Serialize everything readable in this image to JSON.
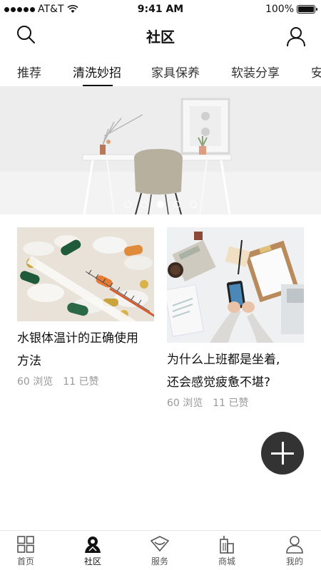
{
  "status_bar": {
    "carrier": "AT&T",
    "time": "9:41 AM",
    "battery": "100%",
    "battery_level": 1.0
  },
  "header": {
    "title": "社区",
    "icons": [
      "search-icon",
      "user-icon"
    ]
  },
  "tabs": [
    {
      "label": "推荐",
      "active": false
    },
    {
      "label": "清洗妙招",
      "active": true
    },
    {
      "label": "家具保养",
      "active": false
    },
    {
      "label": "软装分享",
      "active": false
    },
    {
      "label": "安",
      "active": false
    }
  ],
  "banner": {
    "page_count": 5,
    "active_index": 2
  },
  "articles": [
    {
      "title_line1": "水银体温计的正确使用",
      "title_line2": "方法",
      "views": "60 浏览",
      "likes": "11 已赞"
    },
    {
      "title_line1": "为什么上班都是坐着,",
      "title_line2": "还会感觉疲惫不堪?",
      "views": "60 浏览",
      "likes": "11 已赞"
    }
  ],
  "fab": {
    "icon": "plus-icon"
  },
  "bottom_nav": [
    {
      "label": "首页",
      "icon": "grid-icon",
      "active": false
    },
    {
      "label": "社区",
      "icon": "community-icon",
      "active": true
    },
    {
      "label": "服务",
      "icon": "service-icon",
      "active": false
    },
    {
      "label": "商城",
      "icon": "mall-icon",
      "active": false
    },
    {
      "label": "我的",
      "icon": "profile-icon",
      "active": false
    }
  ]
}
